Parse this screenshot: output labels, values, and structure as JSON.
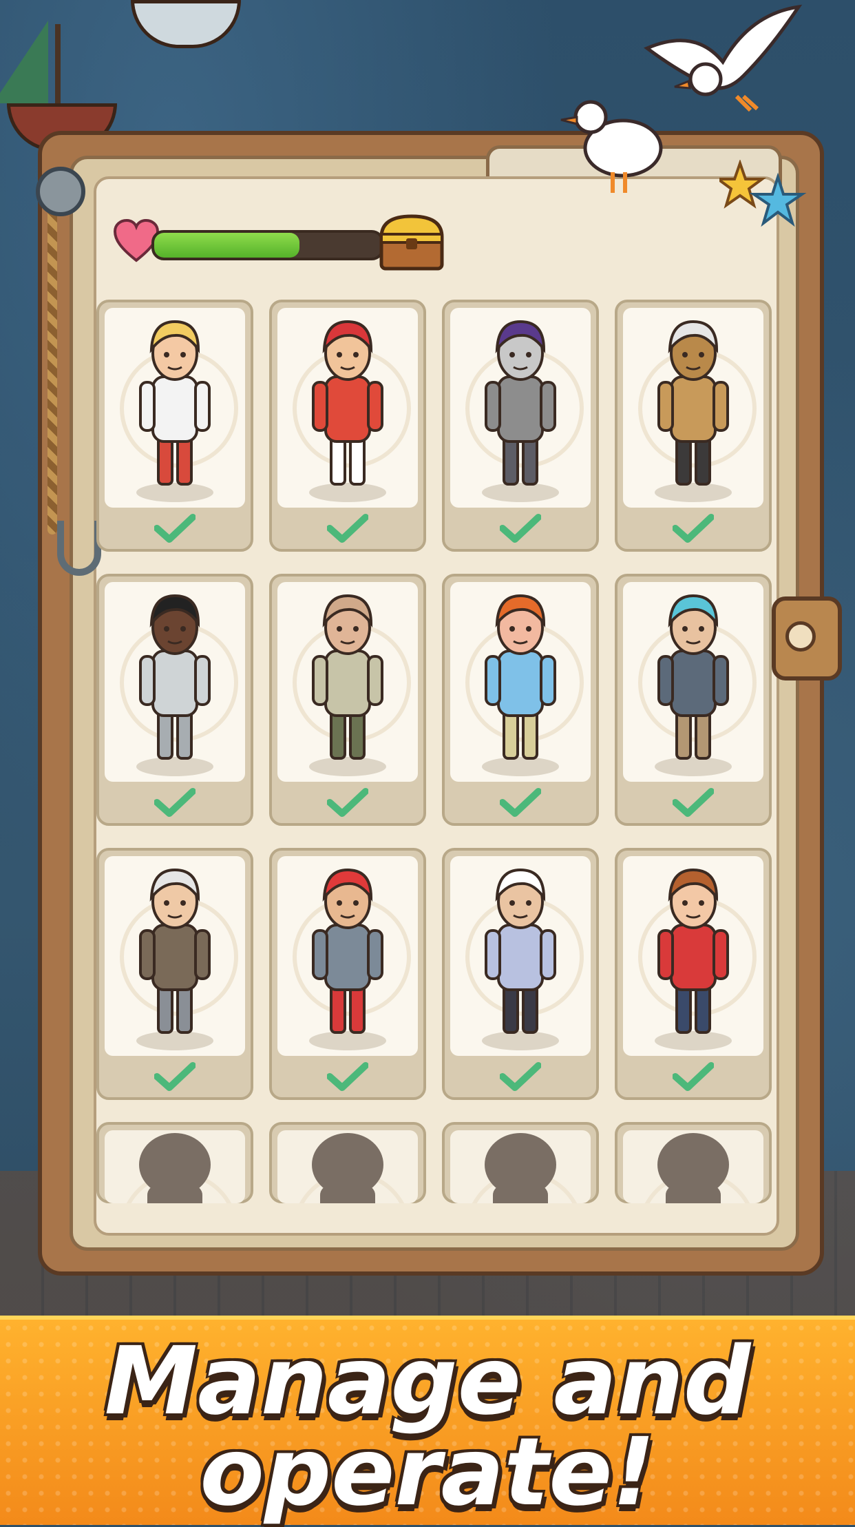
{
  "banner": {
    "line1": "Manage and",
    "line2": "operate!"
  },
  "progress": {
    "fill_fraction": 0.64,
    "heart_icon": "heart-icon",
    "reward_icon": "treasure-chest-icon"
  },
  "characters": [
    {
      "name": "waitress",
      "unlocked": true,
      "shirt": "#f3f3f3",
      "body": "#d84a3c",
      "hair": "#f2cc61",
      "skin": "#f4c9a4"
    },
    {
      "name": "chef",
      "unlocked": true,
      "shirt": "#e04a3a",
      "body": "#ffffff",
      "hair": "#d9373a",
      "skin": "#f1c49a"
    },
    {
      "name": "robot-waiter",
      "unlocked": true,
      "shirt": "#8d8d8d",
      "body": "#5d5d66",
      "hair": "#5a3a8c",
      "skin": "#c8c8c8"
    },
    {
      "name": "robot-maid",
      "unlocked": true,
      "shirt": "#c89a5a",
      "body": "#3c3a3a",
      "hair": "#e6e6e6",
      "skin": "#b9894a"
    },
    {
      "name": "basketball-player",
      "unlocked": true,
      "shirt": "#cfd4d6",
      "body": "#a7adb1",
      "hair": "#222222",
      "skin": "#6b4431"
    },
    {
      "name": "fisherman",
      "unlocked": true,
      "shirt": "#c7c4a8",
      "body": "#6b7352",
      "hair": "#d0a98a",
      "skin": "#e0b597"
    },
    {
      "name": "tourist-boy",
      "unlocked": true,
      "shirt": "#7fc1e8",
      "body": "#d8cf9a",
      "hair": "#e56b2a",
      "skin": "#f2b9a0"
    },
    {
      "name": "mechanic",
      "unlocked": true,
      "shirt": "#5c6a7a",
      "body": "#b39773",
      "hair": "#5ac5d8",
      "skin": "#e8c2a0"
    },
    {
      "name": "old-gentleman",
      "unlocked": true,
      "shirt": "#7a6a58",
      "body": "#8a8f96",
      "hair": "#e6e6e6",
      "skin": "#efc9a6"
    },
    {
      "name": "surfer",
      "unlocked": true,
      "shirt": "#7c8a98",
      "body": "#d83a3a",
      "hair": "#e03a3a",
      "skin": "#e8b890"
    },
    {
      "name": "old-master",
      "unlocked": true,
      "shirt": "#b8c1e0",
      "body": "#3a3a46",
      "hair": "#ffffff",
      "skin": "#eac4a2"
    },
    {
      "name": "young-man",
      "unlocked": true,
      "shirt": "#d93a3a",
      "body": "#3a4a6a",
      "hair": "#b5612f",
      "skin": "#f3c8a6"
    },
    {
      "name": "locked-1",
      "unlocked": false
    },
    {
      "name": "locked-2",
      "unlocked": false
    },
    {
      "name": "locked-3",
      "unlocked": false
    },
    {
      "name": "locked-4",
      "unlocked": false
    }
  ],
  "colors": {
    "check": "#4cb87a",
    "silhouette": "#7a6e64"
  }
}
